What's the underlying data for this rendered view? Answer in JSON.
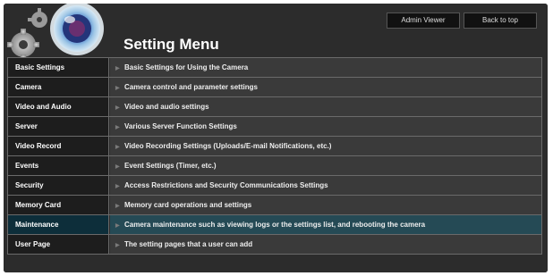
{
  "header": {
    "title": "Setting Menu",
    "admin_viewer_label": "Admin Viewer",
    "back_to_top_label": "Back to top"
  },
  "menu": [
    {
      "label": "Basic Settings",
      "description": "Basic Settings for Using the Camera",
      "active": false
    },
    {
      "label": "Camera",
      "description": "Camera control and parameter settings",
      "active": false
    },
    {
      "label": "Video and Audio",
      "description": "Video and audio settings",
      "active": false
    },
    {
      "label": "Server",
      "description": "Various Server Function Settings",
      "active": false
    },
    {
      "label": "Video Record",
      "description": "Video Recording Settings (Uploads/E-mail Notifications, etc.)",
      "active": false
    },
    {
      "label": "Events",
      "description": "Event Settings (Timer, etc.)",
      "active": false
    },
    {
      "label": "Security",
      "description": "Access Restrictions and Security Communications Settings",
      "active": false
    },
    {
      "label": "Memory Card",
      "description": "Memory card operations and settings",
      "active": false
    },
    {
      "label": "Maintenance",
      "description": "Camera maintenance such as viewing logs or the settings list, and rebooting the camera",
      "active": true
    },
    {
      "label": "User Page",
      "description": "The setting pages that a user can add",
      "active": false
    }
  ],
  "colors": {
    "background": "#2c2c2c",
    "active_row_left": "#0d2e3a",
    "active_row_right": "#254a55"
  },
  "icons": {
    "logo": "camera-lens-and-gears-logo",
    "row_arrow": "triangle-right-icon"
  }
}
